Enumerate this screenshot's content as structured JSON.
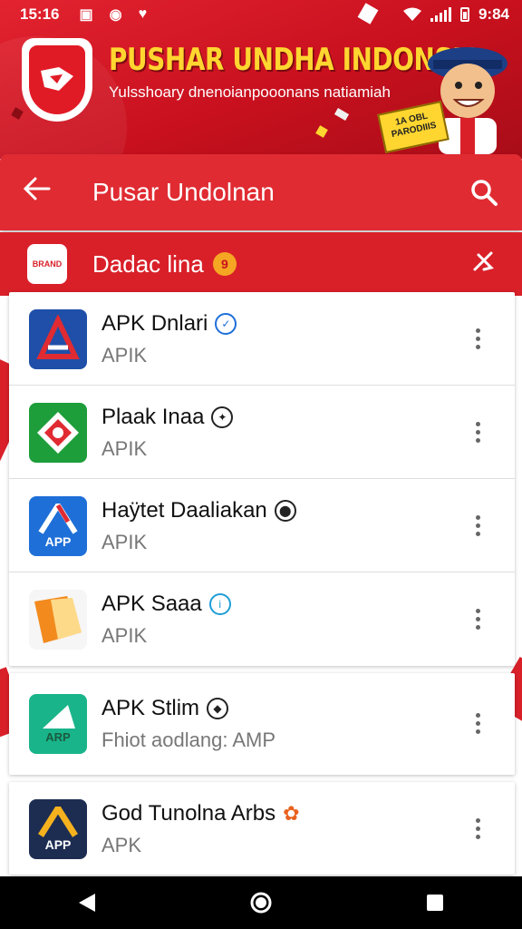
{
  "status_bar": {
    "time": "15:16",
    "clock_right": "9:84"
  },
  "banner": {
    "title": "PUSHAR UNDHA INDONSIA",
    "subtitle": "Yulsshoary dnenoianpooonans natiamiah",
    "tag_text": "1A OBL PARODIIIS"
  },
  "appbar": {
    "title": "Pusar Undolnan"
  },
  "subbar": {
    "logo_text": "BRAND",
    "title": "Dadac lina"
  },
  "apps": [
    {
      "title": "APK Dnlari",
      "subtitle": "APIK",
      "icon_color": "#1f4fa8",
      "icon_label": ""
    },
    {
      "title": "Plaak Inaa",
      "subtitle": "APIK",
      "icon_color": "#1e9e3a",
      "icon_label": ""
    },
    {
      "title": "Haÿtet Daaliakan",
      "subtitle": "APIK",
      "icon_color": "#1e6fd8",
      "icon_label": "APP"
    },
    {
      "title": "APK Saaa",
      "subtitle": "APIK",
      "icon_color": "#f28a1e",
      "icon_label": ""
    },
    {
      "title": "APK Stlim",
      "subtitle": "Fhiot aodlang: AMP",
      "icon_color": "#19b48a",
      "icon_label": "ARP"
    },
    {
      "title": "God Tunolna Arbs",
      "subtitle": "APK",
      "icon_color": "#1d2d52",
      "icon_label": "APP"
    }
  ],
  "colors": {
    "primary": "#e02b32",
    "banner": "#c8101e",
    "accent": "#ffd630"
  }
}
